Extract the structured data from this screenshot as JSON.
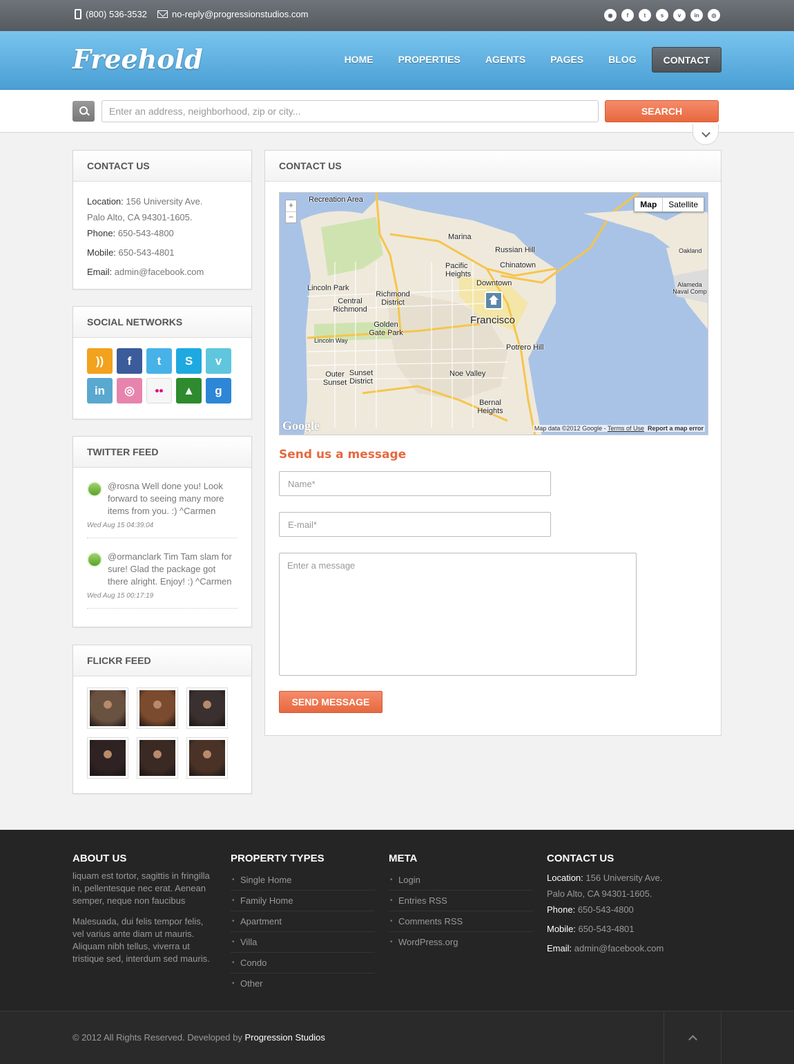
{
  "topbar": {
    "phone": "(800) 536-3532",
    "email": "no-reply@progressionstudios.com",
    "social_icons": [
      "rss-icon",
      "facebook-icon",
      "twitter-icon",
      "skype-icon",
      "vimeo-icon",
      "linkedin-icon",
      "dribbble-icon"
    ]
  },
  "header": {
    "logo": "Freehold",
    "nav": [
      "HOME",
      "PROPERTIES",
      "AGENTS",
      "PAGES",
      "BLOG",
      "CONTACT"
    ],
    "active_nav": "CONTACT"
  },
  "search": {
    "placeholder": "Enter an address, neighborhood, zip or city...",
    "button": "SEARCH"
  },
  "sidebar": {
    "contact": {
      "title": "CONTACT US",
      "location_label": "Location:",
      "location_line1": "156 University Ave.",
      "location_line2": "Palo Alto, CA 94301-1605.",
      "phone_label": "Phone:",
      "phone": "650-543-4800",
      "mobile_label": "Mobile:",
      "mobile": "650-543-4801",
      "email_label": "Email:",
      "email": "admin@facebook.com"
    },
    "social": {
      "title": "SOCIAL NETWORKS",
      "icons": [
        {
          "name": "rss-icon",
          "glyph": "))",
          "color": "#f2a21d"
        },
        {
          "name": "facebook-icon",
          "glyph": "f",
          "color": "#3b5b9b"
        },
        {
          "name": "twitter-icon",
          "glyph": "t",
          "color": "#47b2e8"
        },
        {
          "name": "skype-icon",
          "glyph": "S",
          "color": "#1ea9e0"
        },
        {
          "name": "vimeo-icon",
          "glyph": "v",
          "color": "#5fc6dd"
        },
        {
          "name": "linkedin-icon",
          "glyph": "in",
          "color": "#59a8cf"
        },
        {
          "name": "dribbble-icon",
          "glyph": "◎",
          "color": "#e784ad"
        },
        {
          "name": "flickr-icon",
          "glyph": "••",
          "color": "#f6f6f6"
        },
        {
          "name": "evernote-icon",
          "glyph": "▲",
          "color": "#2e8b2e"
        },
        {
          "name": "google-icon",
          "glyph": "g",
          "color": "#2e86d6"
        }
      ]
    },
    "twitter": {
      "title": "TWITTER FEED",
      "tweets": [
        {
          "text": "@rosna Well done you! Look forward to seeing many more items from you. :) ^Carmen",
          "date": "Wed Aug 15 04:39:04"
        },
        {
          "text": "@ormanclark Tim Tam slam for sure! Glad the package got there alright. Enjoy! :) ^Carmen",
          "date": "Wed Aug 15 00:17:19"
        }
      ]
    },
    "flickr": {
      "title": "FLICKR FEED",
      "photo_colors": [
        "#6a5240",
        "#7a4b2e",
        "#3a3030",
        "#2e2222",
        "#3b2a24",
        "#4a3326"
      ]
    }
  },
  "main": {
    "title": "CONTACT US",
    "map": {
      "type_buttons": [
        "Map",
        "Satellite"
      ],
      "zoom_in": "+",
      "zoom_out": "−",
      "credit": "Map data ©2012 Google -",
      "terms": "Terms of Use",
      "report": "Report a map error",
      "google": "Google",
      "labels": {
        "rec": "Recreation Area",
        "marina": "Marina",
        "russian_hill": "Russian Hill",
        "pacific_heights": "Pacific Heights",
        "chinatown": "Chinatown",
        "lincoln_park": "Lincoln Park",
        "richmond_district": "Richmond District",
        "downtown": "Downtown",
        "central_richmond": "Central Richmond",
        "francisco": "Francisco",
        "golden_gate_park": "Golden Gate Park",
        "lincoln_way": "Lincoln Way",
        "potrero_hill": "Potrero Hill",
        "outer_sunset": "Outer Sunset",
        "sunset_district": "Sunset District",
        "noe_valley": "Noe Valley",
        "bernal_heights": "Bernal Heights",
        "oakland": "Oakland",
        "alameda": "Alameda Naval Comp"
      }
    },
    "form": {
      "title": "Send us a message",
      "name_placeholder": "Name*",
      "email_placeholder": "E-mail*",
      "message_placeholder": "Enter a message",
      "submit": "SEND MESSAGE"
    }
  },
  "footer": {
    "about": {
      "title": "ABOUT US",
      "p1": "liquam est tortor, sagittis in fringilla in, pellentesque nec erat. Aenean semper, neque non faucibus",
      "p2": "Malesuada, dui felis tempor felis, vel varius ante diam ut mauris. Aliquam nibh tellus, viverra ut tristique sed, interdum sed mauris."
    },
    "property_types": {
      "title": "PROPERTY TYPES",
      "items": [
        "Single Home",
        "Family Home",
        "Apartment",
        "Villa",
        "Condo",
        "Other"
      ]
    },
    "meta": {
      "title": "META",
      "items": [
        "Login",
        "Entries RSS",
        "Comments RSS",
        "WordPress.org"
      ]
    },
    "contact": {
      "title": "CONTACT US",
      "location_label": "Location:",
      "location_line1": "156 University Ave.",
      "location_line2": "Palo Alto, CA 94301-1605.",
      "phone_label": "Phone:",
      "phone": "650-543-4800",
      "mobile_label": "Mobile:",
      "mobile": "650-543-4801",
      "email_label": "Email:",
      "email": "admin@facebook.com"
    },
    "copyright_prefix": "© 2012 All Rights Reserved. Developed by",
    "developer": "Progression Studios"
  },
  "colors": {
    "accent": "#e7693f",
    "header_blue": "#4a9fd4",
    "footer_bg": "#252525"
  }
}
